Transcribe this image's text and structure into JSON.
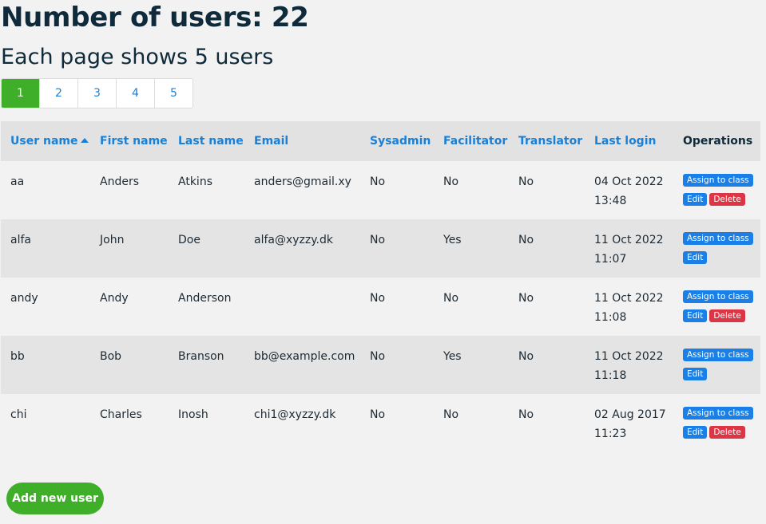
{
  "header": {
    "title": "Number of users: 22",
    "subtitle": "Each page shows 5 users"
  },
  "pagination": {
    "pages": [
      "1",
      "2",
      "3",
      "4",
      "5"
    ],
    "active": "1"
  },
  "table": {
    "columns": {
      "username": "User name",
      "firstname": "First name",
      "lastname": "Last name",
      "email": "Email",
      "sysadmin": "Sysadmin",
      "facilitator": "Facilitator",
      "translator": "Translator",
      "lastlogin": "Last login",
      "operations": "Operations"
    },
    "rows": [
      {
        "username": "aa",
        "firstname": "Anders",
        "lastname": "Atkins",
        "email": "anders@gmail.xy",
        "sysadmin": "No",
        "facilitator": "No",
        "translator": "No",
        "login_date": "04 Oct 2022",
        "login_time": "13:48",
        "can_delete": true
      },
      {
        "username": "alfa",
        "firstname": "John",
        "lastname": "Doe",
        "email": "alfa@xyzzy.dk",
        "sysadmin": "No",
        "facilitator": "Yes",
        "translator": "No",
        "login_date": "11 Oct 2022",
        "login_time": "11:07",
        "can_delete": false
      },
      {
        "username": "andy",
        "firstname": "Andy",
        "lastname": "Anderson",
        "email": "",
        "sysadmin": "No",
        "facilitator": "No",
        "translator": "No",
        "login_date": "11 Oct 2022",
        "login_time": "11:08",
        "can_delete": true
      },
      {
        "username": "bb",
        "firstname": "Bob",
        "lastname": "Branson",
        "email": "bb@example.com",
        "sysadmin": "No",
        "facilitator": "Yes",
        "translator": "No",
        "login_date": "11 Oct 2022",
        "login_time": "11:18",
        "can_delete": false
      },
      {
        "username": "chi",
        "firstname": "Charles",
        "lastname": "Inosh",
        "email": "chi1@xyzzy.dk",
        "sysadmin": "No",
        "facilitator": "No",
        "translator": "No",
        "login_date": "02 Aug 2017",
        "login_time": "11:23",
        "can_delete": true
      }
    ]
  },
  "operations": {
    "assign_label": "Assign to class",
    "edit_label": "Edit",
    "delete_label": "Delete"
  },
  "add_user_label": "Add new user",
  "colors": {
    "accent_green": "#3fae29",
    "link_blue": "#1a7fd6",
    "delete_red": "#dc3545"
  }
}
